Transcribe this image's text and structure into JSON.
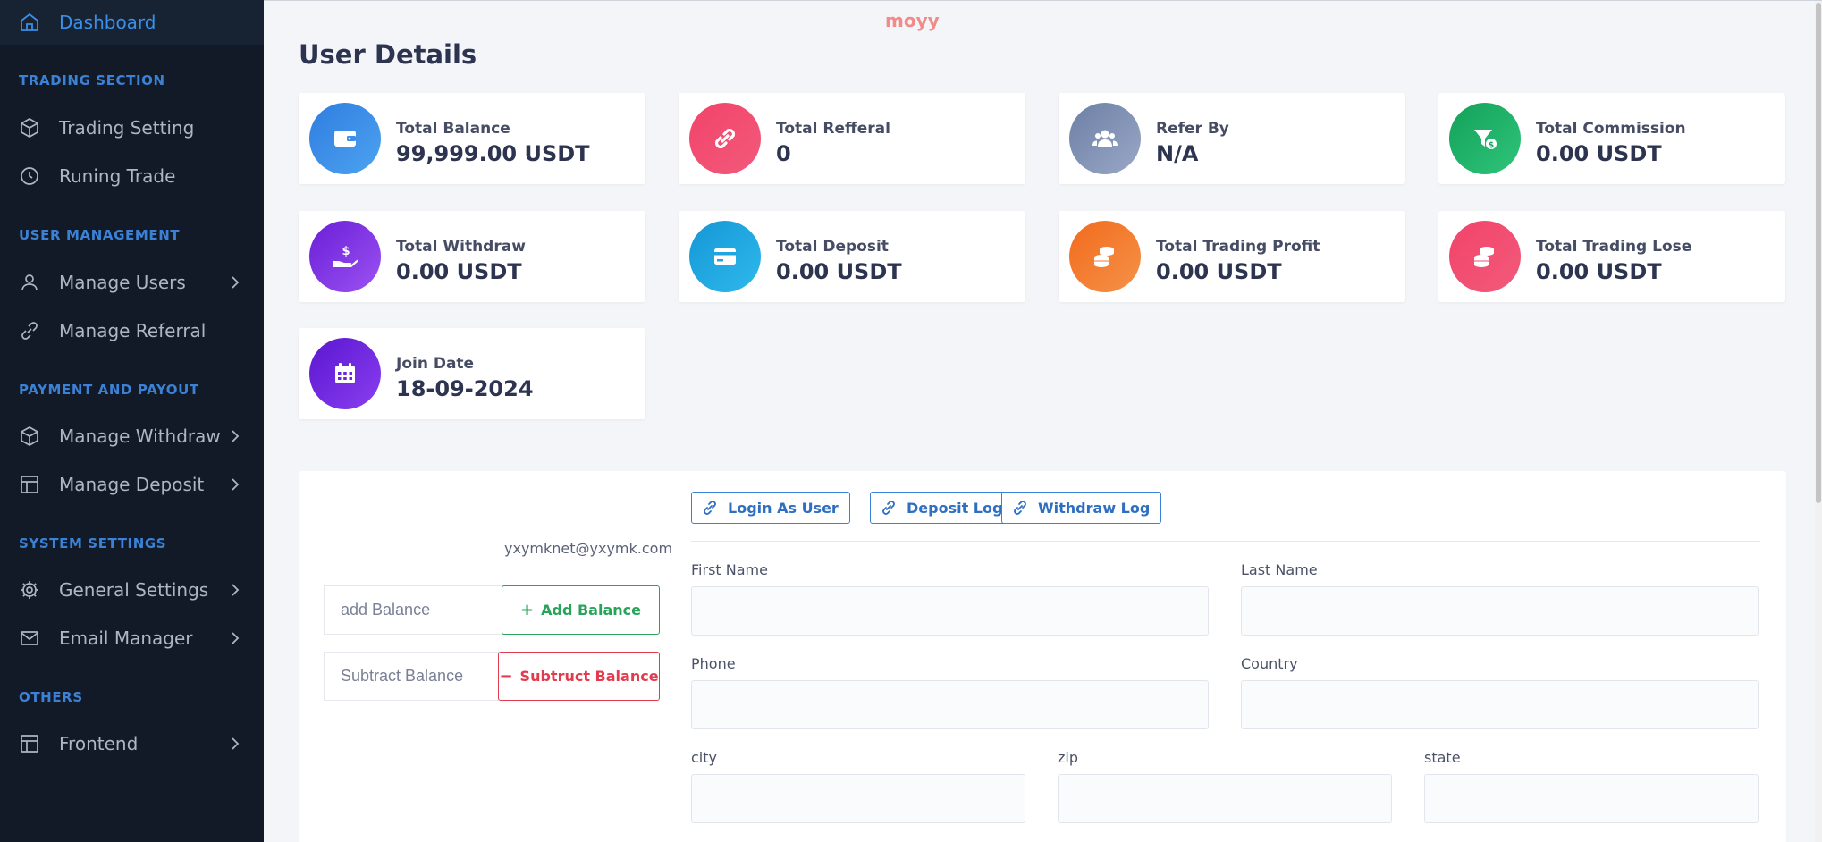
{
  "watermark": "moyy",
  "sidebar": {
    "dashboard": "Dashboard",
    "sections": {
      "trading": "TRADING SECTION",
      "users": "USER MANAGEMENT",
      "payment": "PAYMENT AND PAYOUT",
      "system": "SYSTEM SETTINGS",
      "others": "OTHERS"
    },
    "items": {
      "trading_setting": "Trading Setting",
      "runing_trade": "Runing Trade",
      "manage_users": "Manage Users",
      "manage_referral": "Manage Referral",
      "manage_withdraw": "Manage Withdraw",
      "manage_deposit": "Manage Deposit",
      "general_settings": "General Settings",
      "email_manager": "Email Manager",
      "frontend": "Frontend"
    }
  },
  "page_title": "User Details",
  "cards": {
    "total_balance": {
      "label": "Total Balance",
      "value": "99,999.00 USDT"
    },
    "total_refferal": {
      "label": "Total Refferal",
      "value": "0"
    },
    "refer_by": {
      "label": "Refer By",
      "value": "N/A"
    },
    "total_commission": {
      "label": "Total Commission",
      "value": "0.00 USDT"
    },
    "total_withdraw": {
      "label": "Total Withdraw",
      "value": "0.00 USDT"
    },
    "total_deposit": {
      "label": "Total Deposit",
      "value": "0.00 USDT"
    },
    "total_trading_profit": {
      "label": "Total Trading Profit",
      "value": "0.00 USDT"
    },
    "total_trading_lose": {
      "label": "Total Trading Lose",
      "value": "0.00 USDT"
    },
    "join_date": {
      "label": "Join Date",
      "value": "18-09-2024"
    }
  },
  "colors": {
    "sidebar_bg": "#121a28",
    "accent": "#3b82d6",
    "success": "#2aa35a",
    "danger": "#e23b4e"
  },
  "balance": {
    "email": "yxymknet@yxymk.com",
    "add_placeholder": "add Balance",
    "add_button": "Add Balance",
    "subtract_placeholder": "Subtract Balance",
    "subtract_button": "Subtruct Balance"
  },
  "actions": {
    "login_as_user": "Login As User",
    "deposit_log": "Deposit Log",
    "withdraw_log": "Withdraw Log"
  },
  "form": {
    "first_name": {
      "label": "First Name",
      "value": ""
    },
    "last_name": {
      "label": "Last Name",
      "value": ""
    },
    "phone": {
      "label": "Phone",
      "value": ""
    },
    "country": {
      "label": "Country",
      "value": ""
    },
    "city": {
      "label": "city",
      "value": ""
    },
    "zip": {
      "label": "zip",
      "value": ""
    },
    "state": {
      "label": "state",
      "value": ""
    }
  }
}
